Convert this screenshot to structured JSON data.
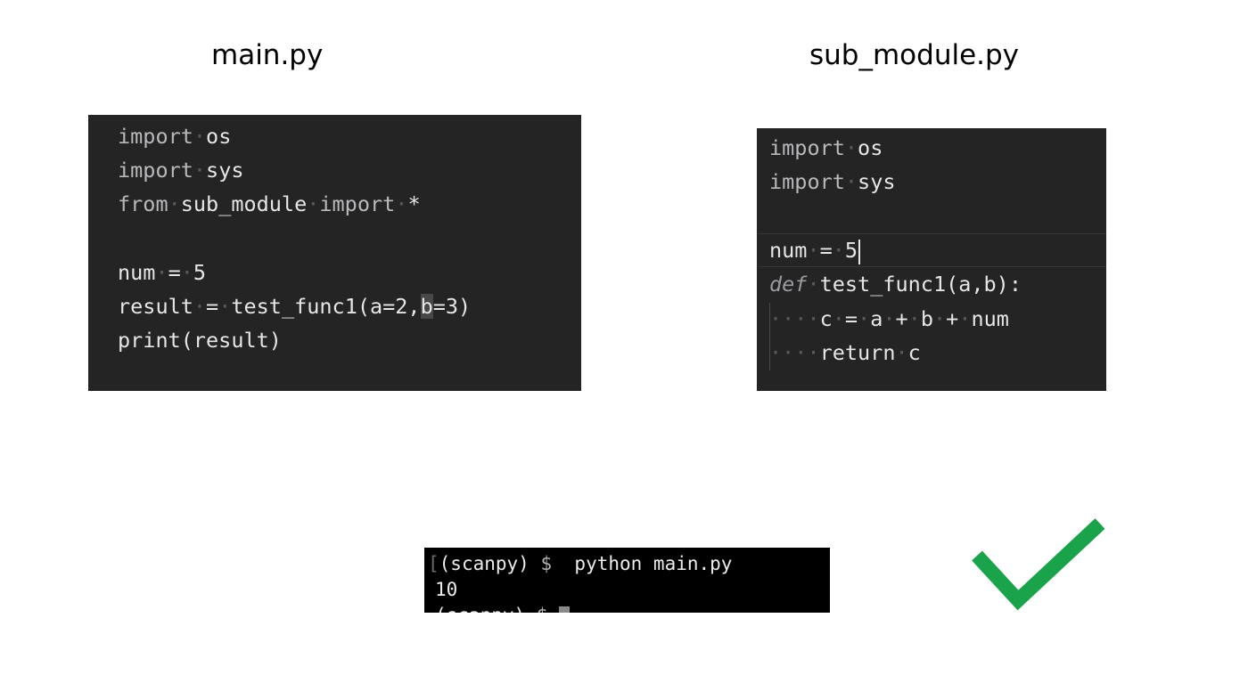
{
  "titles": {
    "main_file": "main.py",
    "sub_file": "sub_module.py"
  },
  "main_code": {
    "line1": {
      "kw": "import",
      "rest": "os"
    },
    "line2": {
      "kw": "import",
      "rest": "sys"
    },
    "line3": {
      "kw1": "from",
      "mod": "sub_module",
      "kw2": "import",
      "star": "*"
    },
    "line5": {
      "name": "num",
      "op": "=",
      "val": "5"
    },
    "line6": {
      "lhs": "result",
      "op": "=",
      "call": "test_func1(a=2,",
      "selected": "b",
      "tail": "=3)"
    },
    "line7": {
      "text": "print(result)"
    }
  },
  "sub_code": {
    "line1": {
      "kw": "import",
      "rest": "os"
    },
    "line2": {
      "kw": "import",
      "rest": "sys"
    },
    "line4": {
      "name": "num",
      "op": "=",
      "val": "5"
    },
    "line5": {
      "kw": "def",
      "sig": "test_func1(a,b):"
    },
    "line6": {
      "c": "c",
      "eq": "=",
      "a": "a",
      "plus1": "+",
      "b": "b",
      "plus2": "+",
      "num": "num"
    },
    "line7": {
      "kw": "return",
      "val": "c"
    }
  },
  "terminal": {
    "prompt_env": "(scanpy)",
    "prompt_symbol": "$",
    "command": "python main.py",
    "output": "10",
    "next_prompt_env": "(scanpy)",
    "next_prompt_symbol": "$"
  },
  "status_icon": {
    "name": "check-icon",
    "color": "#1aa34a"
  },
  "colors": {
    "editor_bg": "#242424",
    "terminal_bg": "#000000"
  }
}
